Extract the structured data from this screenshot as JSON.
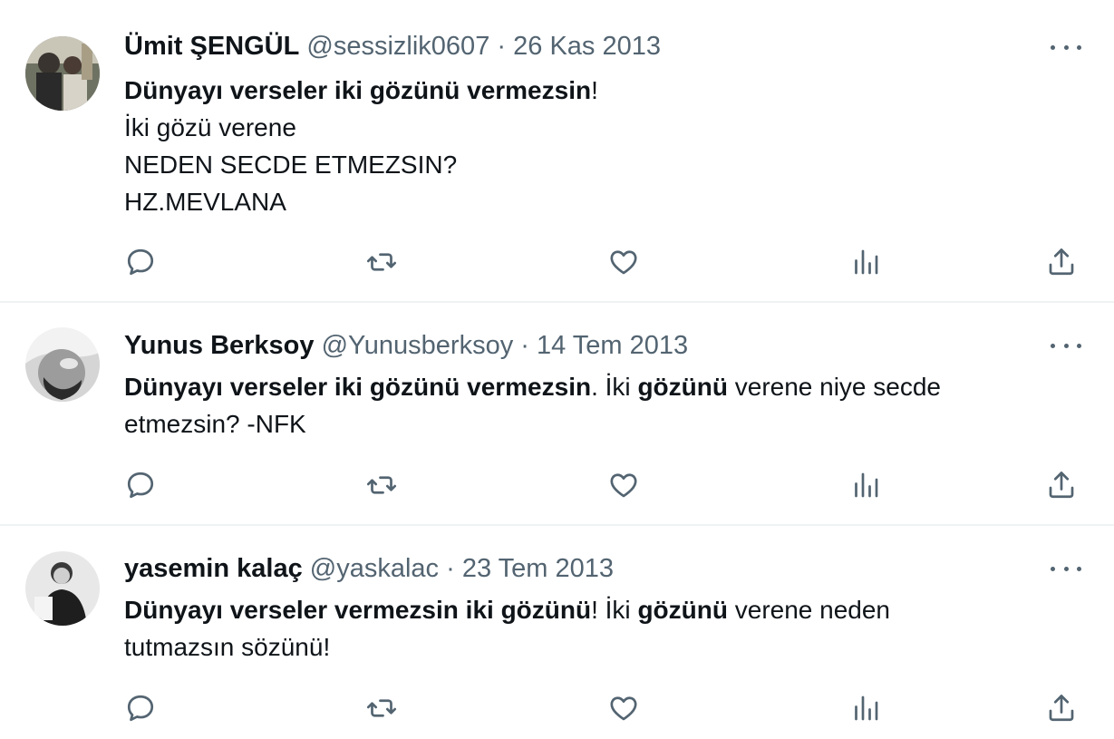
{
  "colors": {
    "text": "#0f1419",
    "secondary": "#536471",
    "divider": "#eff3f4"
  },
  "icons": {
    "reply": "reply-icon",
    "retweet": "retweet-icon",
    "like": "like-icon",
    "views": "views-icon",
    "share": "share-icon",
    "more": "more-icon"
  },
  "tweets": [
    {
      "name": "Ümit ŞENGÜL",
      "handle": "@sessizlik0607",
      "separator": "·",
      "date": "26 Kas 2013",
      "lines": [
        {
          "bold": "Dünyayı verseler iki gözünü vermezsin",
          "rest": "!"
        },
        {
          "text": "İki gözü verene"
        },
        {
          "text": "NEDEN SECDE ETMEZSIN?"
        },
        {
          "text": "HZ.MEVLANA"
        }
      ]
    },
    {
      "name": "Yunus Berksoy",
      "handle": "@Yunusberksoy",
      "separator": "·",
      "date": "14 Tem 2013",
      "lines": [
        {
          "bold": "Dünyayı verseler iki gözünü vermezsin",
          "mid": ". İki ",
          "bold2": "gözünü",
          "rest": " verene niye secde"
        },
        {
          "text": "etmezsin? -NFK"
        }
      ]
    },
    {
      "name": "yasemin kalaç",
      "handle": "@yaskalac",
      "separator": "·",
      "date": "23 Tem 2013",
      "lines": [
        {
          "bold": "Dünyayı verseler vermezsin iki gözünü",
          "mid": "! İki ",
          "bold2": "gözünü",
          "rest": " verene neden"
        },
        {
          "text": "tutmazsın sözünü!"
        }
      ]
    }
  ]
}
